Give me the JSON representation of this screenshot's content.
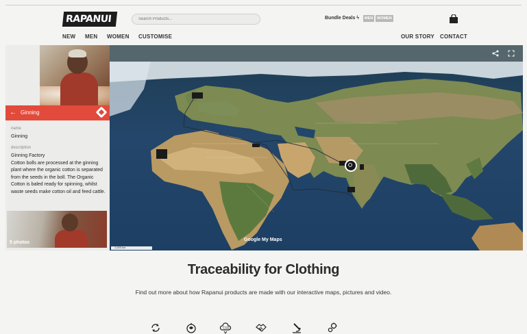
{
  "header": {
    "logo_text": "RAPANUI",
    "search_placeholder": "Search Products...",
    "bundle_label": "Bundle Deals ϟ",
    "bundle_men": "MEN",
    "bundle_women": "WOMEN",
    "cart_icon": "shopping-bag-icon"
  },
  "nav": {
    "left": [
      "NEW",
      "MEN",
      "WOMEN",
      "CUSTOMISE"
    ],
    "right": [
      "OUR STORY",
      "CONTACT"
    ]
  },
  "map_toolbar": {
    "share_icon": "share-icon",
    "fullscreen_icon": "fullscreen-icon"
  },
  "place_panel": {
    "title": "Ginning",
    "name_label": "name",
    "name_value": "Ginning",
    "description_label": "description",
    "description_value": "Ginning Factory\nCotton bolls are processed at the ginning plant where the organic cotton is separated from the seeds in the boll. The Organic Cotton is baled ready for spinning, whilst waste seeds make cotton oil and feed cattle.",
    "photos_label": "5 photos"
  },
  "map": {
    "attribution": "Google My Maps",
    "scale_label": "1,000 km"
  },
  "page": {
    "heading": "Traceability for Clothing",
    "subtext": "Find out more about how Rapanui products are made with our interactive maps, pictures and video."
  },
  "features": [
    "recycle-icon",
    "globe-leaf-icon",
    "co2-cloud-icon",
    "handshake-icon",
    "microscope-icon",
    "gears-icon"
  ],
  "colors": {
    "accent_red": "#e24a3c",
    "map_bar": "#55666c",
    "background": "#f4f4f2"
  }
}
